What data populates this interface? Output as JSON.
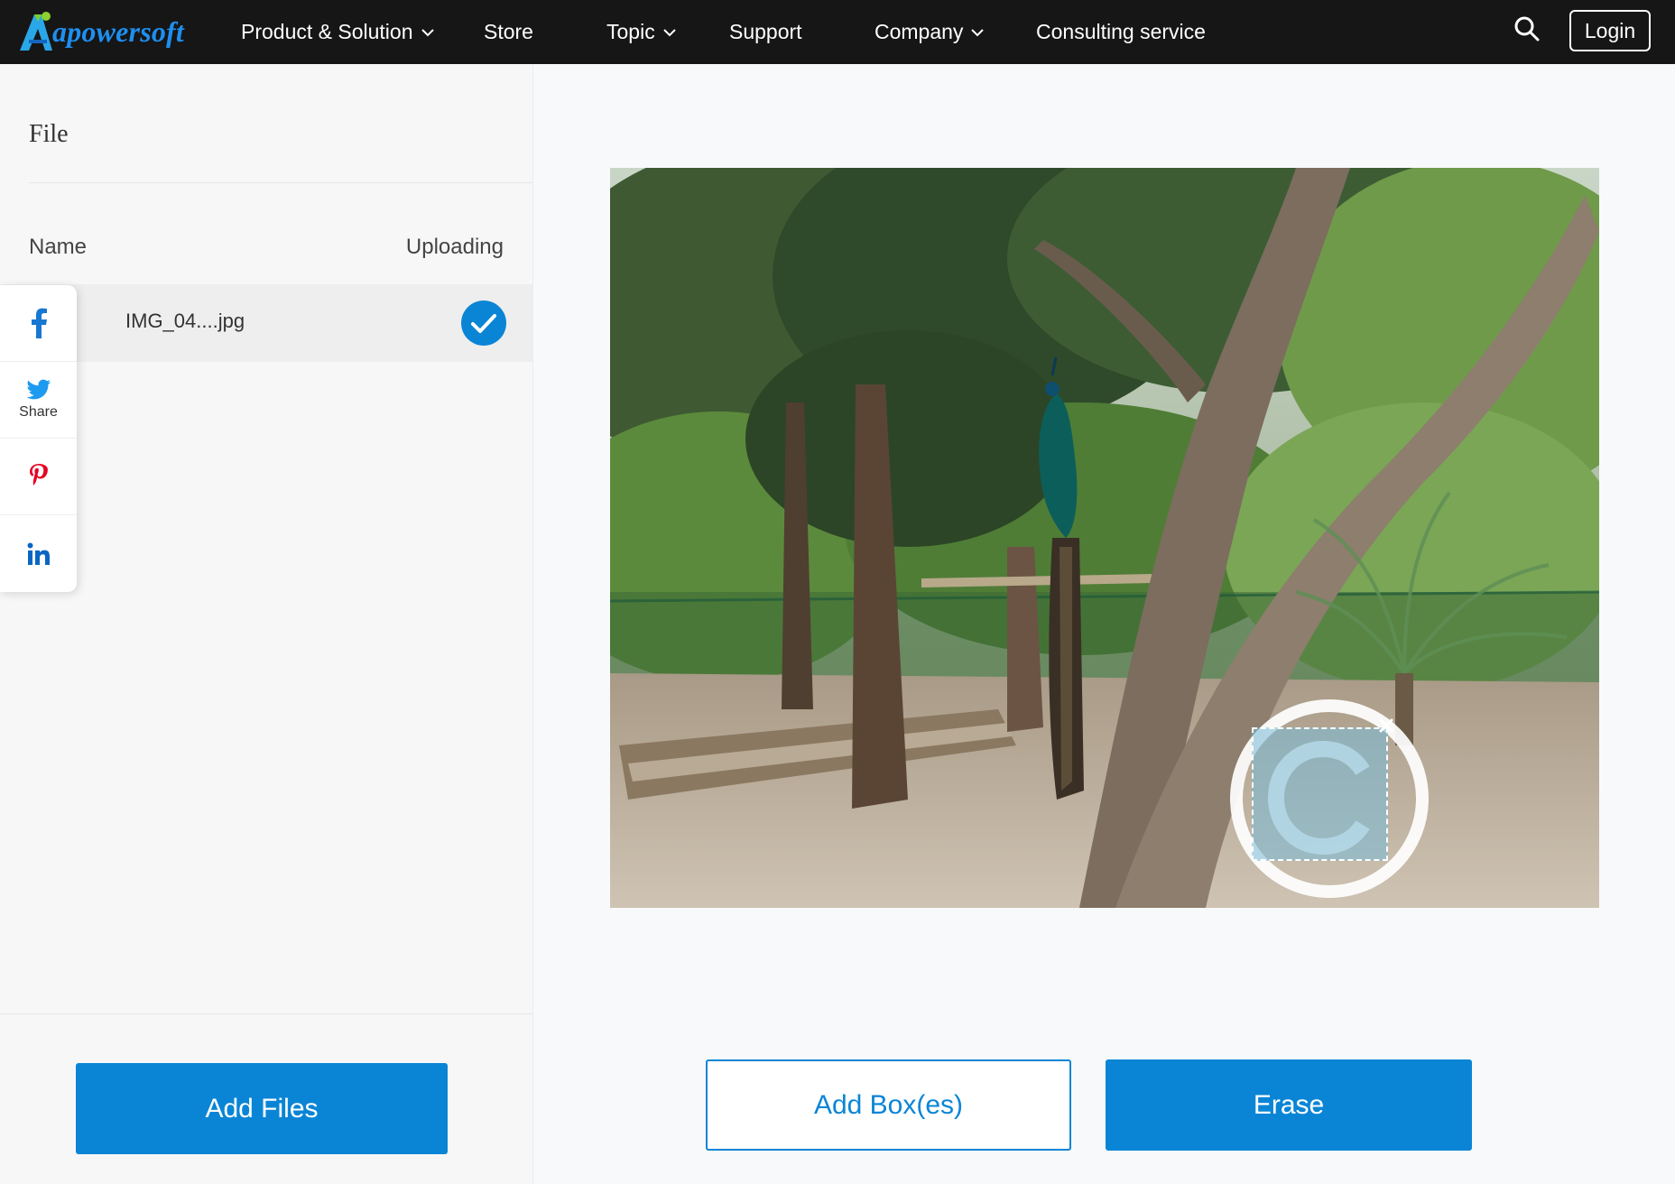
{
  "brand": {
    "name": "apowersoft",
    "logo_letter": "A"
  },
  "nav": {
    "items": [
      {
        "label": "Product & Solution",
        "dropdown": true
      },
      {
        "label": "Store",
        "dropdown": false
      },
      {
        "label": "Topic",
        "dropdown": true
      },
      {
        "label": "Support",
        "dropdown": false
      },
      {
        "label": "Company",
        "dropdown": true
      },
      {
        "label": "Consulting service",
        "dropdown": false
      }
    ],
    "search_icon": "search-icon",
    "login_label": "Login"
  },
  "file_panel": {
    "title": "File",
    "columns": {
      "name": "Name",
      "status": "Uploading"
    },
    "files": [
      {
        "name": "IMG_04....jpg",
        "status": "uploaded"
      }
    ],
    "add_files_label": "Add Files"
  },
  "share_bar": {
    "items": [
      {
        "icon": "facebook-icon",
        "label": ""
      },
      {
        "icon": "twitter-icon",
        "label": "Share"
      },
      {
        "icon": "pinterest-icon",
        "label": ""
      },
      {
        "icon": "linkedin-icon",
        "label": ""
      }
    ]
  },
  "editor": {
    "image_subject": "peacock perched on a branch among trees",
    "watermark_icon": "copyright-watermark",
    "add_boxes_label": "Add Box(es)",
    "erase_label": "Erase"
  },
  "colors": {
    "accent": "#0a85d6",
    "nav_bg": "#161616",
    "brand": "#1e8ff0"
  }
}
